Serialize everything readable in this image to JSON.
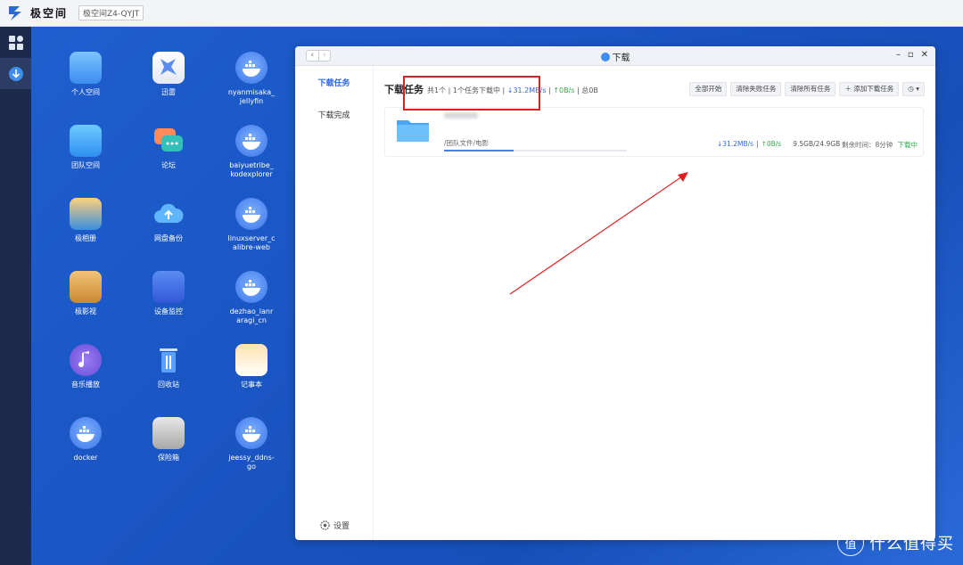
{
  "topbar": {
    "brand": "极空间",
    "device": "极空间Z4-QYJT"
  },
  "desktop": {
    "apps": [
      {
        "label": "个人空间",
        "icon": "folder-icon"
      },
      {
        "label": "迅雷",
        "icon": "thunder-icon"
      },
      {
        "label": "nyanmisaka_\njellyfin",
        "icon": "docker-icon"
      },
      {
        "label": "团队空间",
        "icon": "team-folder-icon"
      },
      {
        "label": "论坛",
        "icon": "forum-icon"
      },
      {
        "label": "baiyuetribe_\nkodexplorer",
        "icon": "docker-icon"
      },
      {
        "label": "极相册",
        "icon": "album-icon"
      },
      {
        "label": "网盘备份",
        "icon": "cloud-backup-icon"
      },
      {
        "label": "linuxserver_c\nalibre-web",
        "icon": "docker-icon"
      },
      {
        "label": "极影视",
        "icon": "video-icon"
      },
      {
        "label": "设备监控",
        "icon": "monitor-icon"
      },
      {
        "label": "dezhao_lanr\naragi_cn",
        "icon": "docker-icon"
      },
      {
        "label": "音乐播放",
        "icon": "music-icon"
      },
      {
        "label": "回收站",
        "icon": "trash-icon"
      },
      {
        "label": "记事本",
        "icon": "notepad-icon"
      },
      {
        "label": "docker",
        "icon": "docker-icon"
      },
      {
        "label": "保险箱",
        "icon": "safe-icon"
      },
      {
        "label": "jeessy_ddns-\ngo",
        "icon": "docker-icon"
      }
    ]
  },
  "window": {
    "title": "下载",
    "sidebar": {
      "items": [
        {
          "label": "下载任务"
        },
        {
          "label": "下载完成"
        }
      ],
      "settings": "设置"
    },
    "header": {
      "title": "下载任务",
      "summary_a": "共1个 | 1个任务下载中 |",
      "down": "↓31.2MB/s",
      "sep1": "|",
      "up": "↑0B/s",
      "sep2": "|",
      "total": "总0B"
    },
    "actions": [
      "全部开始",
      "清除失败任务",
      "清除所有任务",
      "＋ 添加下载任务",
      "◷ ▾"
    ],
    "task": {
      "path": "/团队文件/电影",
      "down": "↓31.2MB/s",
      "sep": "|",
      "up": "↑0B/s",
      "size": "9.5GB/24.9GB",
      "remain": "剩余时间：8分钟",
      "state": "下载中",
      "progress": 0.38
    }
  },
  "watermark": {
    "glyph": "值",
    "text": "什么值得买"
  },
  "colors": {
    "accent": "#2f6ae0",
    "green": "#2fae4a",
    "highlight": "#e02020"
  }
}
